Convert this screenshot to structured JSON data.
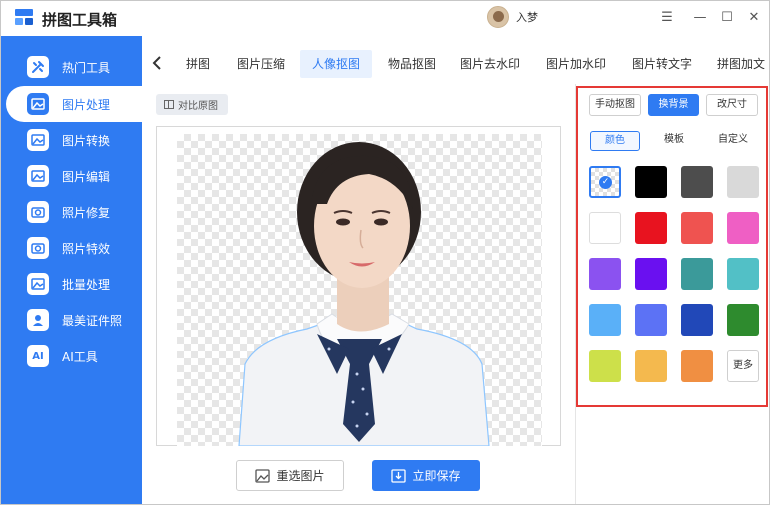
{
  "app": {
    "title": "拼图工具箱",
    "username": "入梦"
  },
  "window_controls": {
    "menu": "☰",
    "minimize": "—",
    "maximize": "☐",
    "close": "✕"
  },
  "sidebar": {
    "items": [
      {
        "label": "热门工具",
        "icon": "tools-icon"
      },
      {
        "label": "图片处理",
        "icon": "image-process-icon",
        "active": true
      },
      {
        "label": "图片转换",
        "icon": "image-convert-icon"
      },
      {
        "label": "图片编辑",
        "icon": "image-edit-icon"
      },
      {
        "label": "照片修复",
        "icon": "photo-repair-icon"
      },
      {
        "label": "照片特效",
        "icon": "photo-effect-icon"
      },
      {
        "label": "批量处理",
        "icon": "batch-icon"
      },
      {
        "label": "最美证件照",
        "icon": "id-photo-icon"
      },
      {
        "label": "AI工具",
        "icon": "ai-icon",
        "icon_text": "AI"
      }
    ]
  },
  "tabs": [
    "拼图",
    "图片压缩",
    "人像抠图",
    "物品抠图",
    "图片去水印",
    "图片加水印",
    "图片转文字",
    "拼图加文"
  ],
  "active_tab": "人像抠图",
  "canvas": {
    "compare_label": "对比原图"
  },
  "actions": {
    "reselect_label": "重选图片",
    "save_label": "立即保存"
  },
  "panel": {
    "modes": [
      "手动抠图",
      "换背景",
      "改尺寸"
    ],
    "active_mode": "换背景",
    "sub_tabs": [
      "颜色",
      "模板",
      "自定义"
    ],
    "active_sub_tab": "颜色",
    "colors": [
      "transparent",
      "#000000",
      "#4d4d4d",
      "#d9d9d9",
      "#ffffff",
      "#e8131f",
      "#ef5350",
      "#ef5fc4",
      "#8b52f0",
      "#6a10f0",
      "#3b9a9a",
      "#52c0c6",
      "#5ab0f8",
      "#5c72f5",
      "#2148b8",
      "#2e8b2e",
      "#cde04a",
      "#f4b94e",
      "#f08f42"
    ],
    "more_label": "更多"
  },
  "accent_color": "#2f7bf2"
}
